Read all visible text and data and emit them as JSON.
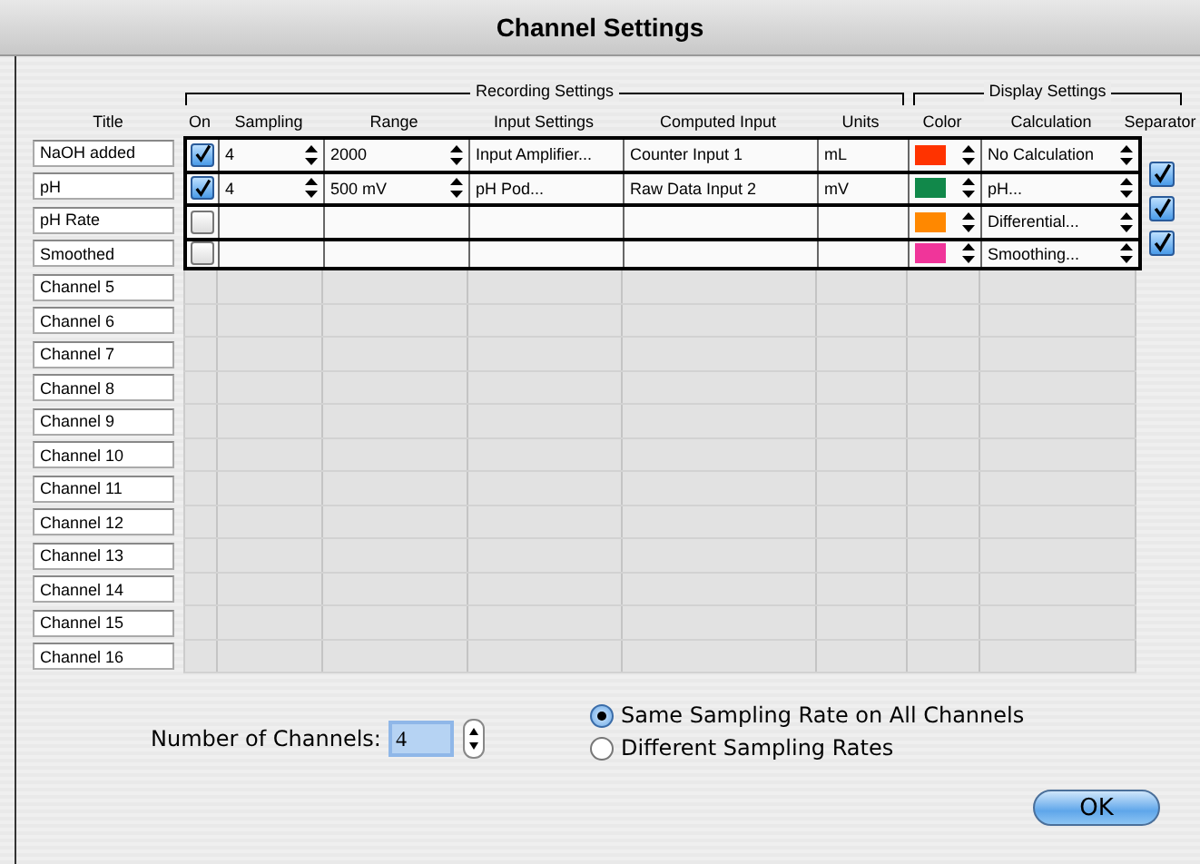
{
  "window": {
    "title": "Channel Settings"
  },
  "groups": {
    "recording": "Recording Settings",
    "display": "Display Settings"
  },
  "columns": [
    "Title",
    "On",
    "Sampling",
    "Range",
    "Input Settings",
    "Computed Input",
    "Units",
    "Color",
    "Calculation",
    "Separator"
  ],
  "rows": [
    {
      "title": "NaOH added",
      "active": true,
      "on": true,
      "sampling": "4",
      "range": "2000",
      "input_settings": "Input Amplifier...",
      "computed_input": "Counter Input 1",
      "units": "mL",
      "color": "#ff3300",
      "calculation": "No Calculation"
    },
    {
      "title": "pH",
      "active": true,
      "on": true,
      "sampling": "4",
      "range": "500 mV",
      "input_settings": "pH Pod...",
      "computed_input": "Raw Data Input 2",
      "units": "mV",
      "color": "#11884a",
      "calculation": "pH..."
    },
    {
      "title": "pH Rate",
      "active": true,
      "on": false,
      "color": "#ff8800",
      "calculation": "Differential..."
    },
    {
      "title": "Smoothed",
      "active": true,
      "on": false,
      "color": "#f0359a",
      "calculation": "Smoothing..."
    },
    {
      "title": "Channel 5",
      "active": false
    },
    {
      "title": "Channel 6",
      "active": false
    },
    {
      "title": "Channel 7",
      "active": false
    },
    {
      "title": "Channel 8",
      "active": false
    },
    {
      "title": "Channel 9",
      "active": false
    },
    {
      "title": "Channel 10",
      "active": false
    },
    {
      "title": "Channel 11",
      "active": false
    },
    {
      "title": "Channel 12",
      "active": false
    },
    {
      "title": "Channel 13",
      "active": false
    },
    {
      "title": "Channel 14",
      "active": false
    },
    {
      "title": "Channel 15",
      "active": false
    },
    {
      "title": "Channel 16",
      "active": false
    }
  ],
  "separators": [
    {
      "checked": true
    },
    {
      "checked": true
    },
    {
      "checked": true
    }
  ],
  "number_of_channels": {
    "label": "Number of Channels:",
    "value": "4"
  },
  "sampling_mode": [
    {
      "label": "Same Sampling Rate on All Channels",
      "selected": true
    },
    {
      "label": "Different Sampling Rates",
      "selected": false
    }
  ],
  "buttons": [
    {
      "label": "OK"
    }
  ]
}
